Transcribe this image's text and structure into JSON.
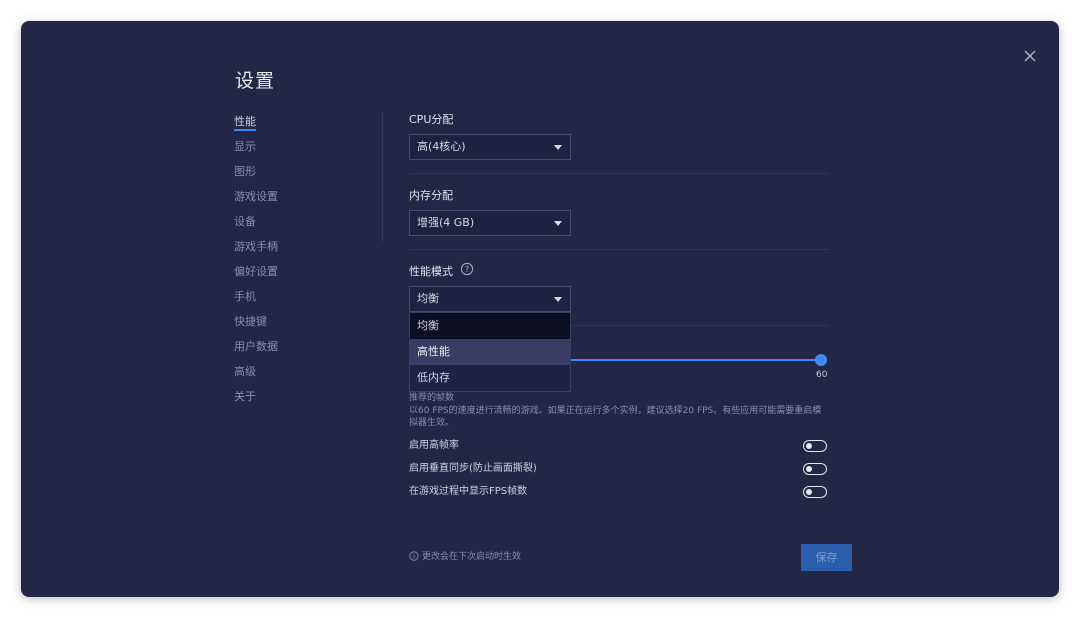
{
  "title": "设置",
  "sidebar": {
    "items": [
      {
        "label": "性能"
      },
      {
        "label": "显示"
      },
      {
        "label": "图形"
      },
      {
        "label": "游戏设置"
      },
      {
        "label": "设备"
      },
      {
        "label": "游戏手柄"
      },
      {
        "label": "偏好设置"
      },
      {
        "label": "手机"
      },
      {
        "label": "快捷键"
      },
      {
        "label": "用户数据"
      },
      {
        "label": "高级"
      },
      {
        "label": "关于"
      }
    ]
  },
  "cpu": {
    "title": "CPU分配",
    "value": "高(4核心)"
  },
  "memory": {
    "title": "内存分配",
    "value": "增强(4 GB)"
  },
  "perf_mode": {
    "title": "性能模式",
    "value": "均衡",
    "options": [
      "均衡",
      "高性能",
      "低内存"
    ]
  },
  "fps": {
    "value": "60",
    "recommend_label": "推荐的帧数",
    "note": "以60 FPS的速度进行流畅的游戏。如果正在运行多个实例，建议选择20 FPS。有些应用可能需要重启模拟器生效。"
  },
  "toggles": [
    {
      "label": "启用高帧率",
      "on": false
    },
    {
      "label": "启用垂直同步(防止画面撕裂)",
      "on": false
    },
    {
      "label": "在游戏过程中显示FPS帧数",
      "on": false
    }
  ],
  "footer": {
    "note": "更改会在下次启动时生效",
    "save_label": "保存"
  },
  "colors": {
    "background": "#232644",
    "accent": "#3d8af7"
  }
}
